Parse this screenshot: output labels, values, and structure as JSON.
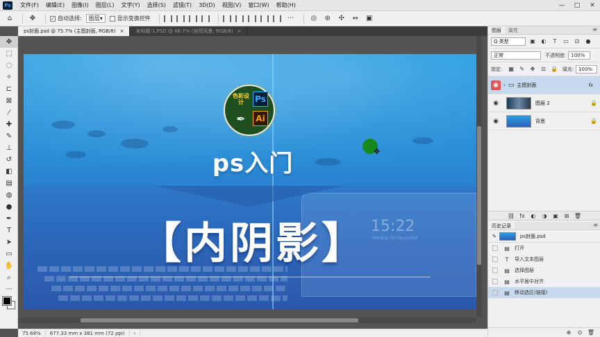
{
  "menubar": {
    "logo": "Ps",
    "items": [
      "文件(F)",
      "编辑(E)",
      "图像(I)",
      "图层(L)",
      "文字(Y)",
      "选择(S)",
      "滤镜(T)",
      "3D(D)",
      "视图(V)",
      "窗口(W)",
      "帮助(H)"
    ],
    "window_controls": [
      "—",
      "□",
      "✕"
    ]
  },
  "options": {
    "auto_select_label": "自动选择:",
    "auto_select_target": "图层",
    "show_transform_label": "显示变换控件",
    "more": "···"
  },
  "tabs": [
    {
      "label": "ps封面.psd @ 75.7% (主图封面, RGB/8)",
      "close": "×"
    },
    {
      "label": "未标题-1.PSD @ 66.7% (自然风景, RGB/8)",
      "close": "×"
    }
  ],
  "canvas": {
    "badge_cn": "色彩设计",
    "badge_ps": "Ps",
    "badge_ai": "Ai",
    "title_ps": "ps入门",
    "title_big": "【内阴影】",
    "clock": "15:22",
    "clock_sub": "Monday 22 December"
  },
  "status": {
    "zoom": "75.68%",
    "dims": "677.33 mm x 381 mm (72 ppi)",
    "arrow": "›"
  },
  "layers_panel": {
    "tabs": [
      "图层",
      "属性"
    ],
    "menu": "≡",
    "filter_kind": "Q 类型",
    "blend_mode": "正常",
    "opacity_label": "不透明度:",
    "opacity_value": "100%",
    "lock_label": "锁定:",
    "fill_label": "填充:",
    "fill_value": "100%",
    "layers": [
      {
        "name": "主图封面",
        "type": "group",
        "fx": "fx",
        "selected": true
      },
      {
        "name": "图层 2",
        "type": "image",
        "locked": true
      },
      {
        "name": "背景",
        "type": "background",
        "locked": true
      }
    ],
    "footer_icons": [
      "⛓",
      "fx",
      "◐",
      "◑",
      "▣",
      "⊞",
      "🗑"
    ]
  },
  "history_panel": {
    "tabs": [
      "历史记录"
    ],
    "snapshot": "ps封面.psd",
    "items": [
      {
        "label": "打开",
        "icon": "▤"
      },
      {
        "label": "导入文本图层",
        "icon": "T"
      },
      {
        "label": "选择图层",
        "icon": "▤"
      },
      {
        "label": "水平居中对齐",
        "icon": "▤"
      },
      {
        "label": "移动选区(链接)",
        "icon": "▤",
        "selected": true
      }
    ],
    "footer_icons": [
      "⊕",
      "⊙",
      "🗑"
    ]
  }
}
